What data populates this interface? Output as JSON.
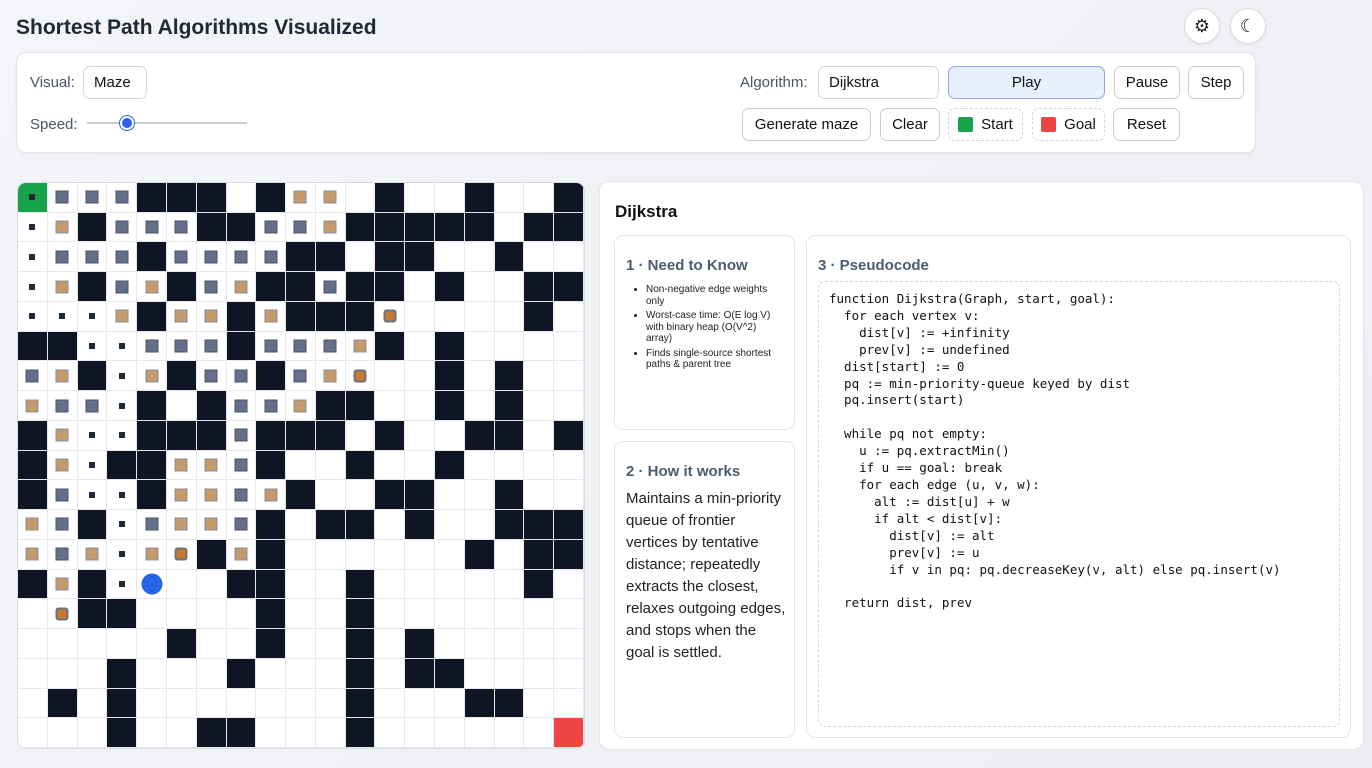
{
  "app": {
    "title": "Shortest Path Algorithms Visualized"
  },
  "top_icons": {
    "settings": "⚙",
    "theme": "☾"
  },
  "controls": {
    "visual_label": "Visual:",
    "visual_value": "Maze",
    "speed_label": "Speed:",
    "speed_value": 0.25,
    "algorithm_label": "Algorithm:",
    "algorithm_value": "Dijkstra",
    "play": "Play",
    "pause": "Pause",
    "step": "Step",
    "generate": "Generate maze",
    "clear": "Clear",
    "start": "Start",
    "goal": "Goal",
    "reset": "Reset"
  },
  "colors": {
    "start": "#16a34a",
    "goal": "#ef4444",
    "wall": "#0f1524",
    "visited": "#64708a",
    "frontier": "#c49a6c",
    "current": "#2563eb",
    "accent": "#2563eb"
  },
  "grid": {
    "rows": [
      "SvvvWWW.Wff.W..W..W",
      "pfWvvvWWvvfWWWWW.WW",
      "pvvvWvvvvWW.WW..W..",
      "pfWvfWvfWWvWW.W..WW",
      "ppsfWffWfWWWc....W.",
      "WWssvvvWvvvfW.W....",
      "vfWsfWvvWvfc..W.W..",
      "fvvsW.WvvfWW..W.W..",
      "WfssWWWvWWW.W..WW.W",
      "WfsWWffvW..W..W....",
      "WvssWffvfW..WW..W..",
      "fvWsvffvW.WW.W..WWW",
      "fvfsfcWfW......W.WW",
      "WfWsU..WW..W.....W.",
      ".cWW....W..W.......",
      ".....W..W..W.W.....",
      "...W...W...W.WW....",
      ".W.W.......W...WW..",
      "...W..WW...W......G"
    ]
  },
  "info": {
    "title": "Dijkstra",
    "know": {
      "heading": "1 · Need to Know",
      "items": [
        "Non-negative edge weights only",
        "Worst-case time: O(E log V) with binary heap (O(V^2) array)",
        "Finds single-source shortest paths & parent tree"
      ]
    },
    "how": {
      "heading": "2 · How it works",
      "text": "Maintains a min-priority queue of frontier vertices by tentative distance; repeatedly extracts the closest, relaxes outgoing edges, and stops when the goal is settled."
    },
    "pseudo": {
      "heading": "3 · Pseudocode",
      "code": "function Dijkstra(Graph, start, goal):\n  for each vertex v:\n    dist[v] := +infinity\n    prev[v] := undefined\n  dist[start] := 0\n  pq := min-priority-queue keyed by dist\n  pq.insert(start)\n\n  while pq not empty:\n    u := pq.extractMin()\n    if u == goal: break\n    for each edge (u, v, w):\n      alt := dist[u] + w\n      if alt < dist[v]:\n        dist[v] := alt\n        prev[v] := u\n        if v in pq: pq.decreaseKey(v, alt) else pq.insert(v)\n\n  return dist, prev"
    }
  }
}
